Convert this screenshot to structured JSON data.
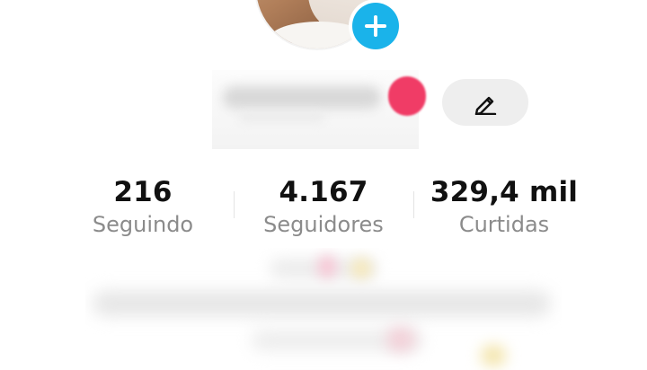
{
  "profile": {
    "avatar_icon": "profile-photo",
    "add_icon": "plus-icon"
  },
  "edit_profile": {
    "icon": "pencil-icon"
  },
  "stats": [
    {
      "value": "216",
      "label": "Seguindo"
    },
    {
      "value": "4.167",
      "label": "Seguidores"
    },
    {
      "value": "329,4 mil",
      "label": "Curtidas"
    }
  ],
  "colors": {
    "background": "#ffffff",
    "plus_badge": "#1ab3ea",
    "pink_tag": "#f03c66",
    "edit_button": "#eeeeee",
    "stat_value": "#111111",
    "stat_label": "#8b8b8b",
    "divider": "#e4e4e4"
  }
}
